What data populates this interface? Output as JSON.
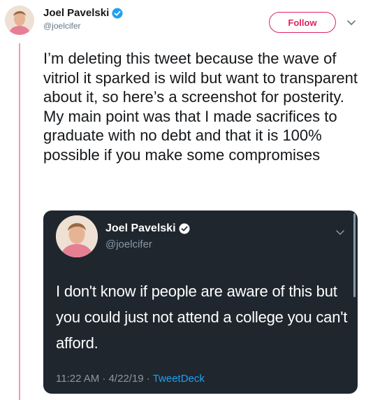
{
  "author": {
    "name": "Joel Pavelski",
    "handle": "@joelcifer",
    "verified_icon": "verified-badge-icon"
  },
  "actions": {
    "follow_label": "Follow",
    "more_icon": "chevron-down-icon"
  },
  "tweet": {
    "text": "I’m deleting this tweet because the wave of vitriol it sparked is wild but want to transparent about it, so here’s a screenshot for posterity. My main point was that I made sacrifices to graduate with no debt and that it is 100% possible if you make some compromises"
  },
  "screenshot_card": {
    "author": {
      "name": "Joel Pavelski",
      "handle": "@joelcifer"
    },
    "text": "I don't know if people are aware of this but you could just not attend a college you can't afford.",
    "time": "11:22 AM · 4/22/19 · ",
    "source": "TweetDeck"
  },
  "colors": {
    "follow": "#e0245e",
    "link": "#1da1f2",
    "card_bg": "#1f262e",
    "verified": "#1da1f2"
  }
}
